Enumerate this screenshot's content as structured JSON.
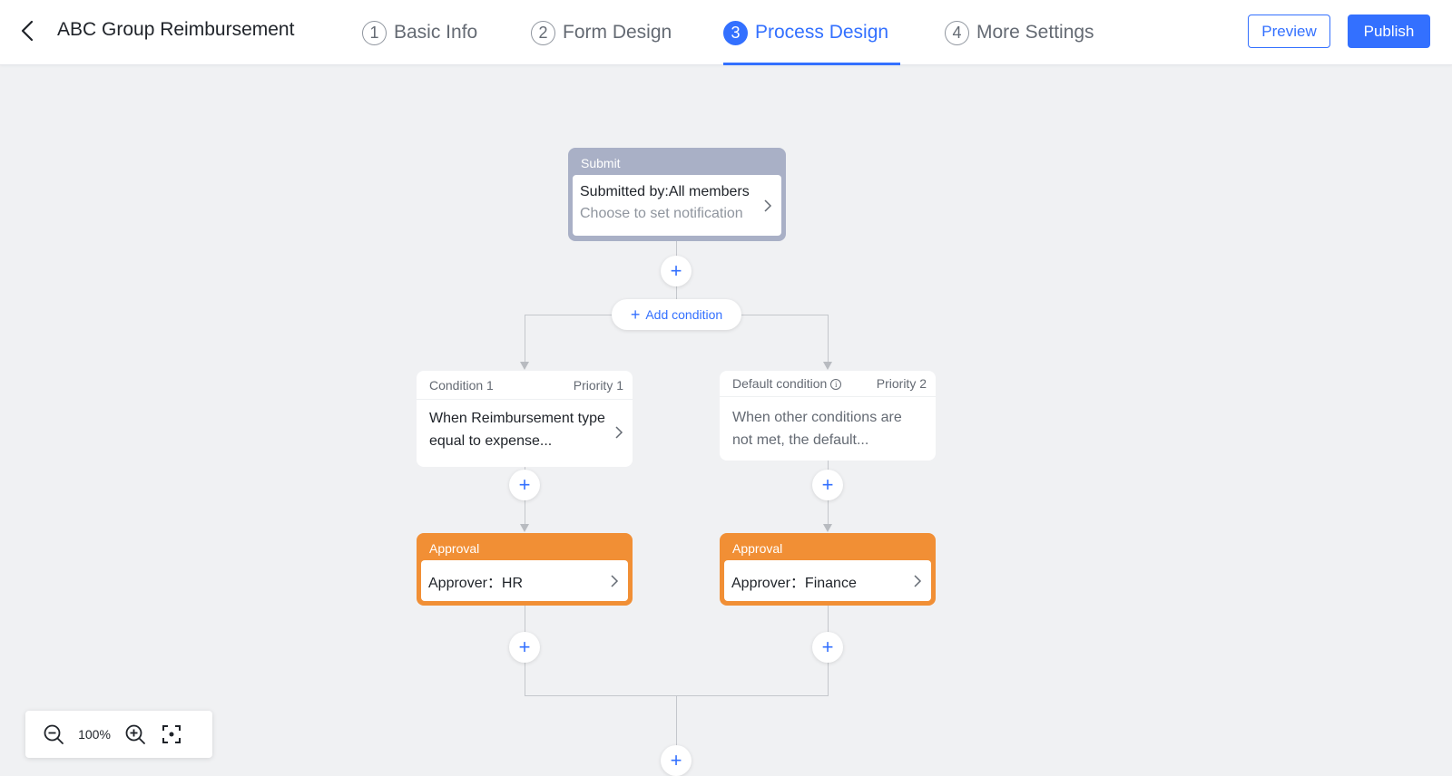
{
  "header": {
    "title": "ABC Group Reimbursement",
    "steps": [
      {
        "num": "1",
        "label": "Basic Info"
      },
      {
        "num": "2",
        "label": "Form Design"
      },
      {
        "num": "3",
        "label": "Process Design"
      },
      {
        "num": "4",
        "label": "More Settings"
      }
    ],
    "active_step": 3,
    "preview_label": "Preview",
    "publish_label": "Publish"
  },
  "flow": {
    "submit": {
      "header": "Submit",
      "line1": "Submitted by:All members",
      "line2": "Choose to set notification"
    },
    "add_condition_label": "Add condition",
    "conditions": [
      {
        "name": "Condition 1",
        "priority": "Priority 1",
        "text": "When Reimbursement type equal to expense..."
      },
      {
        "name": "Default condition",
        "priority": "Priority 2",
        "text": "When other conditions are not met, the default..."
      }
    ],
    "approvals": [
      {
        "header": "Approval",
        "text": "Approver：HR"
      },
      {
        "header": "Approval",
        "text": "Approver：Finance"
      }
    ]
  },
  "zoom": {
    "level": "100%"
  },
  "colors": {
    "accent": "#3370ff",
    "submit_node": "#a9b0c6",
    "approval_node": "#f18f35",
    "canvas": "#f0f1f3"
  },
  "icons": {
    "back": "chevron-left-icon",
    "zoom_out": "zoom-out-icon",
    "zoom_in": "zoom-in-icon",
    "fit": "fit-screen-icon",
    "info": "info-icon",
    "chevron": "chevron-right-icon",
    "plus": "plus-icon"
  }
}
